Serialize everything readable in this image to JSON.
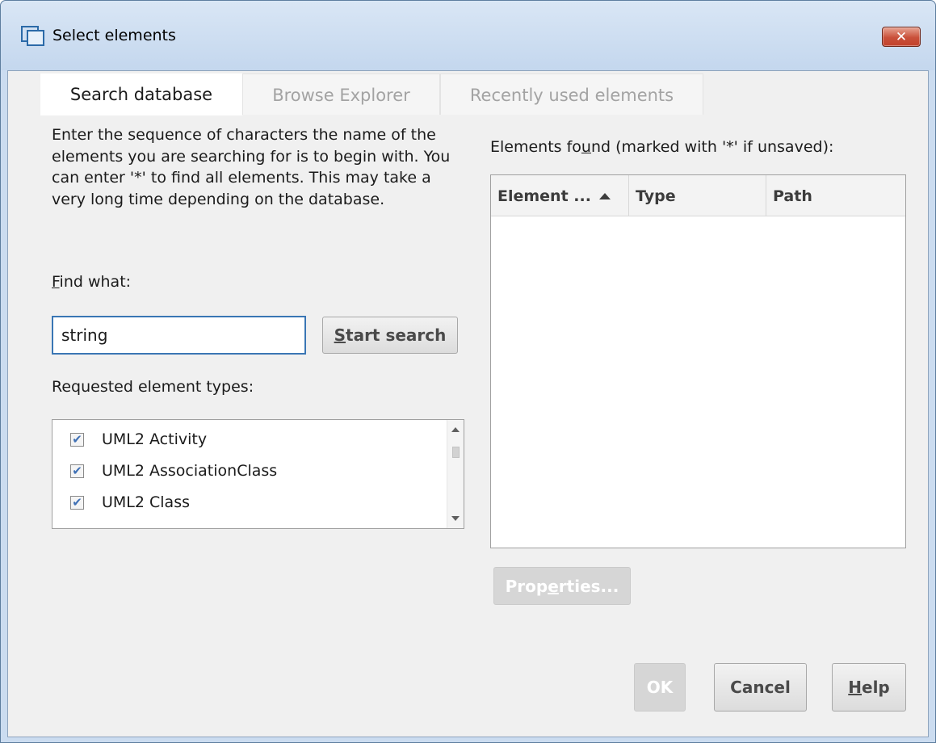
{
  "window": {
    "title": "Select elements",
    "close_symbol": "✕",
    "title_icon": "window-icon"
  },
  "tabs": [
    {
      "label": "Search database",
      "active": true
    },
    {
      "label": "Browse Explorer",
      "active": false
    },
    {
      "label": "Recently used elements",
      "active": false
    }
  ],
  "search": {
    "description": "Enter the sequence of characters the name of the elements you are searching for is to begin with. You can enter '*' to find all elements. This may take a very long time depending on the database.",
    "find_label": "Find what:",
    "find_value": "string",
    "start_button": "Start search",
    "types_label": "Requested element types:",
    "types": [
      {
        "label": "UML2 Activity",
        "checked": true
      },
      {
        "label": "UML2 AssociationClass",
        "checked": true
      },
      {
        "label": "UML2 Class",
        "checked": true
      }
    ]
  },
  "results": {
    "label": "Elements found (marked with '*' if unsaved):",
    "columns": [
      "Element ...",
      "Type",
      "Path"
    ],
    "sort": "ascending",
    "rows": []
  },
  "buttons": {
    "properties": "Properties...",
    "ok": "OK",
    "cancel": "Cancel",
    "help": "Help"
  },
  "colors": {
    "accent": "#3a76b4",
    "close": "#c9503a",
    "disabled": "#d6d6d6"
  }
}
